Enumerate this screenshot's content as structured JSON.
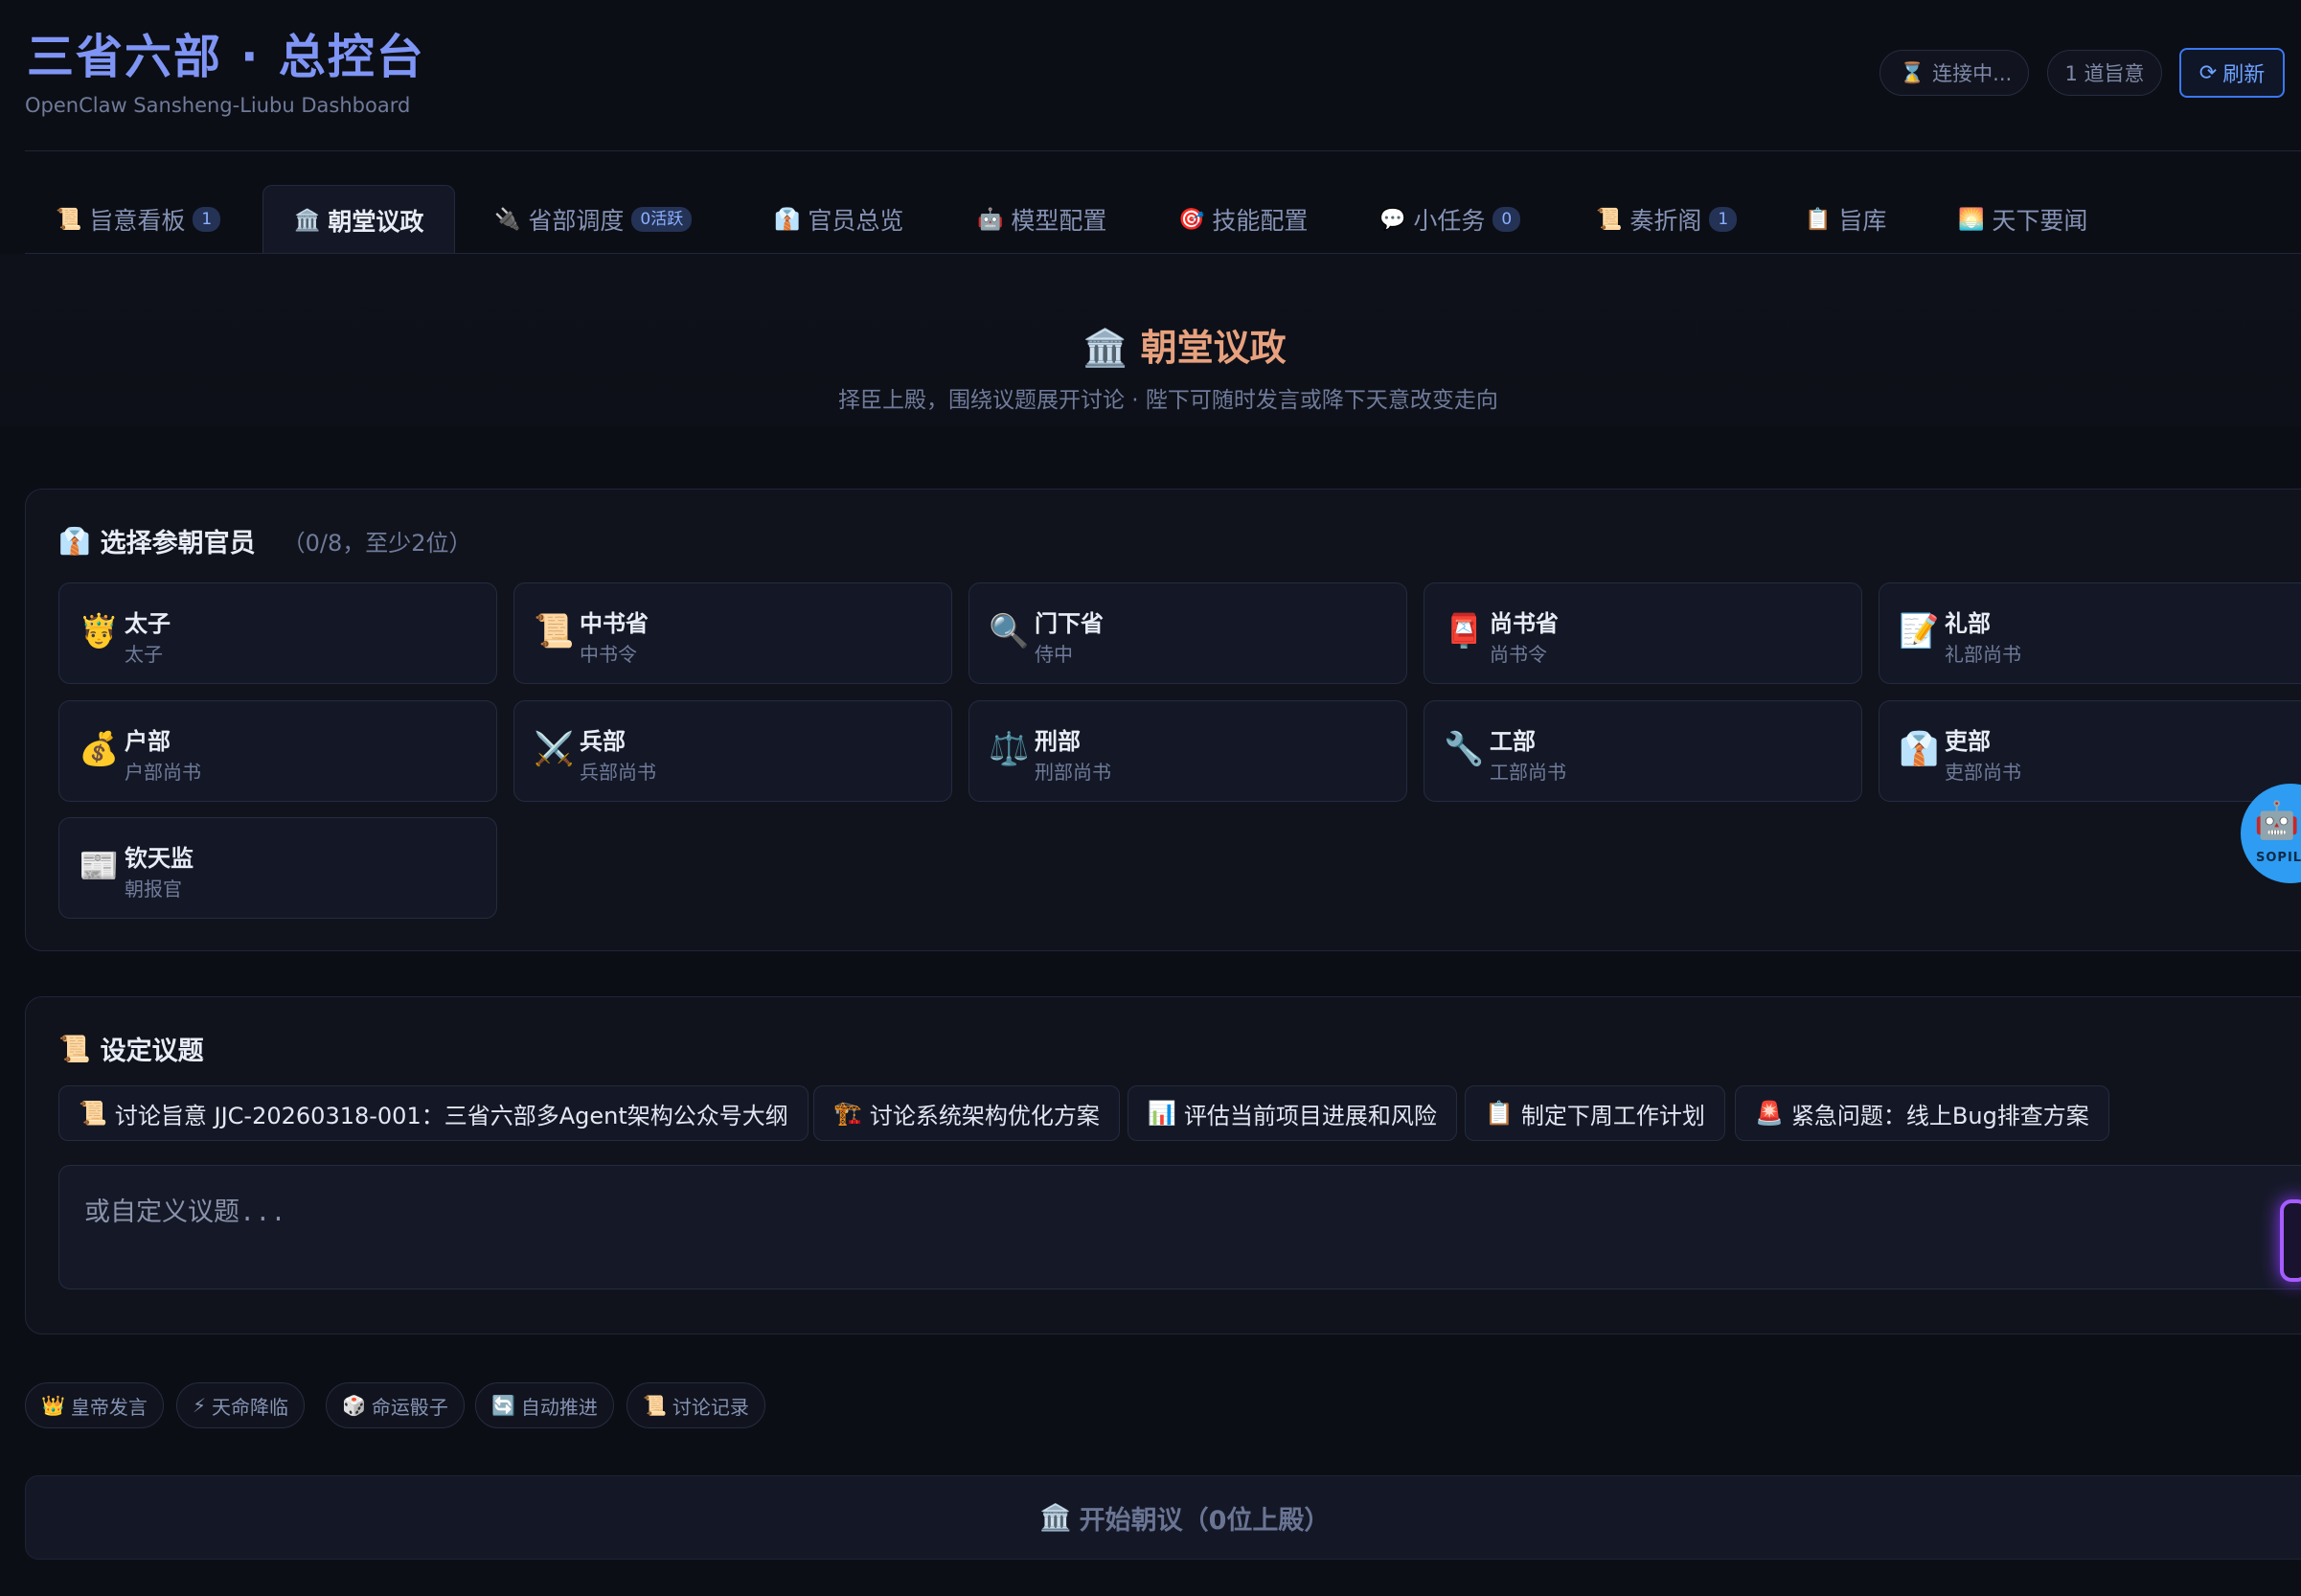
{
  "header": {
    "title": "三省六部 · 总控台",
    "subtitle": "OpenClaw Sansheng-Liubu Dashboard",
    "status_icon": "⌛",
    "status_text": "连接中...",
    "decree_count": "1 道旨意",
    "refresh_icon": "⟳",
    "refresh_label": "刷新"
  },
  "tabs": [
    {
      "icon": "📜",
      "label": "旨意看板",
      "badge": "1"
    },
    {
      "icon": "🏛️",
      "label": "朝堂议政",
      "badge": ""
    },
    {
      "icon": "🔌",
      "label": "省部调度",
      "badge": "0活跃"
    },
    {
      "icon": "👔",
      "label": "官员总览",
      "badge": ""
    },
    {
      "icon": "🤖",
      "label": "模型配置",
      "badge": ""
    },
    {
      "icon": "🎯",
      "label": "技能配置",
      "badge": ""
    },
    {
      "icon": "💬",
      "label": "小任务",
      "badge": "0"
    },
    {
      "icon": "📜",
      "label": "奏折阁",
      "badge": "1"
    },
    {
      "icon": "📋",
      "label": "旨库",
      "badge": ""
    },
    {
      "icon": "🌅",
      "label": "天下要闻",
      "badge": ""
    }
  ],
  "hero": {
    "icon": "🏛️",
    "title": "朝堂议政",
    "subtitle": "择臣上殿，围绕议题展开讨论 · 陛下可随时发言或降下天意改变走向"
  },
  "officials": {
    "icon": "👔",
    "heading": "选择参朝官员",
    "hint": "（0/8，至少2位）",
    "items": [
      {
        "icon": "🤴",
        "name": "太子",
        "role": "太子"
      },
      {
        "icon": "📜",
        "name": "中书省",
        "role": "中书令"
      },
      {
        "icon": "🔍",
        "name": "门下省",
        "role": "侍中"
      },
      {
        "icon": "📮",
        "name": "尚书省",
        "role": "尚书令"
      },
      {
        "icon": "📝",
        "name": "礼部",
        "role": "礼部尚书"
      },
      {
        "icon": "💰",
        "name": "户部",
        "role": "户部尚书"
      },
      {
        "icon": "⚔️",
        "name": "兵部",
        "role": "兵部尚书"
      },
      {
        "icon": "⚖️",
        "name": "刑部",
        "role": "刑部尚书"
      },
      {
        "icon": "🔧",
        "name": "工部",
        "role": "工部尚书"
      },
      {
        "icon": "👔",
        "name": "吏部",
        "role": "吏部尚书"
      },
      {
        "icon": "📰",
        "name": "钦天监",
        "role": "朝报官"
      }
    ]
  },
  "topic": {
    "icon": "📜",
    "heading": "设定议题",
    "suggestions": [
      {
        "icon": "📜",
        "label": "讨论旨意 JJC-20260318-001：三省六部多Agent架构公众号大纲"
      },
      {
        "icon": "🏗️",
        "label": "讨论系统架构优化方案"
      },
      {
        "icon": "📊",
        "label": "评估当前项目进展和风险"
      },
      {
        "icon": "📋",
        "label": "制定下周工作计划"
      },
      {
        "icon": "🚨",
        "label": "紧急问题：线上Bug排查方案"
      }
    ],
    "placeholder": "或自定义议题..."
  },
  "tools": [
    {
      "icon": "👑",
      "label": "皇帝发言"
    },
    {
      "icon": "⚡",
      "label": "天命降临"
    },
    {
      "icon": "🎲",
      "label": "命运骰子"
    },
    {
      "icon": "🔄",
      "label": "自动推进"
    },
    {
      "icon": "📜",
      "label": "讨论记录"
    }
  ],
  "start_button": {
    "icon": "🏛️",
    "label": "开始朝议（0位上殿）"
  },
  "float_helper": {
    "icon": "🤖",
    "label": "SOPIL"
  }
}
